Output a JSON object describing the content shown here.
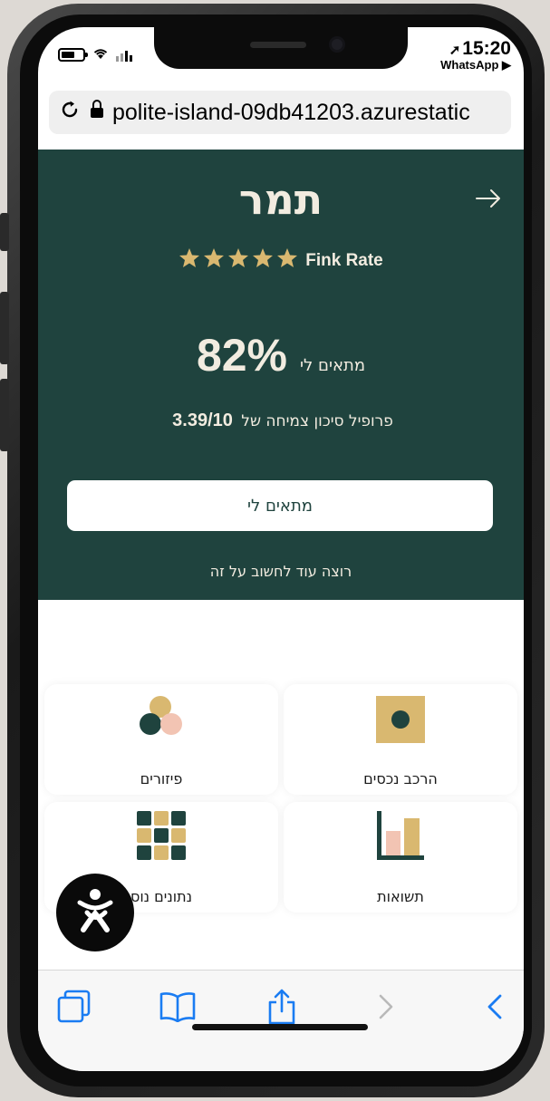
{
  "status_bar": {
    "time": "15:20",
    "back_app": "WhatsApp ▶"
  },
  "browser": {
    "url": "polite-island-09db41203.azurestatic"
  },
  "hero": {
    "name": "תמר",
    "rating_label": "Fink Rate",
    "stars": 5,
    "match_percent": "82%",
    "match_label": "מתאים לי",
    "risk_prefix": "פרופיל סיכון צמיחה של",
    "risk_value": "3.39/10",
    "cta_label": "מתאים לי",
    "think_link": "רוצה עוד לחשוב על זה"
  },
  "cards": [
    {
      "id": "asset-mix",
      "label": "הרכב נכסים",
      "icon": "asset-mix-icon"
    },
    {
      "id": "dispersion",
      "label": "פיזורים",
      "icon": "dispersion-icon"
    },
    {
      "id": "returns",
      "label": "תשואות",
      "icon": "returns-bar-chart-icon"
    },
    {
      "id": "more-data",
      "label": "נתונים נוס",
      "icon": "data-grid-icon"
    }
  ],
  "colors": {
    "brand_dark_green": "#1f433e",
    "gold": "#d9b870",
    "peach": "#f2c4b3",
    "ios_blue": "#1a7cf2"
  }
}
